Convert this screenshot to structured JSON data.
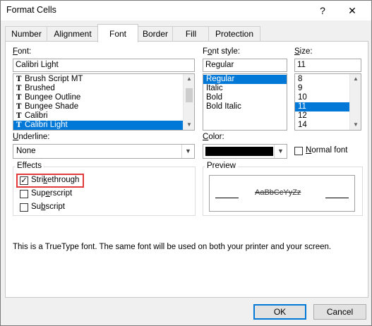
{
  "window": {
    "title": "Format Cells",
    "help_glyph": "?",
    "close_glyph": "✕"
  },
  "tabs": [
    {
      "label": "Number"
    },
    {
      "label": "Alignment"
    },
    {
      "label": "Font"
    },
    {
      "label": "Border"
    },
    {
      "label": "Fill"
    },
    {
      "label": "Protection"
    }
  ],
  "font": {
    "label_key": "F",
    "label_rest": "ont:",
    "value": "Calibri Light",
    "items": [
      "Brush Script MT",
      "Brushed",
      "Bungee Outline",
      "Bungee Shade",
      "Calibri",
      "Calibri Light"
    ],
    "tt_glyph": "T"
  },
  "font_style": {
    "label_pre": "F",
    "label_key": "o",
    "label_rest": "nt style:",
    "value": "Regular",
    "items": [
      "Regular",
      "Italic",
      "Bold",
      "Bold Italic"
    ]
  },
  "size": {
    "label_key": "S",
    "label_rest": "ize:",
    "value": "11",
    "items": [
      "8",
      "9",
      "10",
      "11",
      "12",
      "14"
    ]
  },
  "underline": {
    "label_key": "U",
    "label_rest": "nderline:",
    "value": "None"
  },
  "color": {
    "label_key": "C",
    "label_rest": "olor:",
    "swatch": "#000000"
  },
  "normal_font": {
    "label_key": "N",
    "label_rest": "ormal font",
    "checked": false
  },
  "effects": {
    "title": "Effects",
    "strikethrough": {
      "pre": "Stri",
      "key": "k",
      "rest": "ethrough",
      "checked": true,
      "check_glyph": "✓"
    },
    "superscript": {
      "pre": "Sup",
      "key": "e",
      "rest": "rscript",
      "checked": false
    },
    "subscript": {
      "pre": "Su",
      "key": "b",
      "rest": "script",
      "checked": false
    }
  },
  "preview": {
    "title": "Preview",
    "sample": "AaBbCcYyZz"
  },
  "info_text": "This is a TrueType font.  The same font will be used on both your printer and your screen.",
  "buttons": {
    "ok": "OK",
    "cancel": "Cancel"
  },
  "colors": {
    "selection": "#0078d7",
    "highlight_box": "#e03a3a"
  }
}
